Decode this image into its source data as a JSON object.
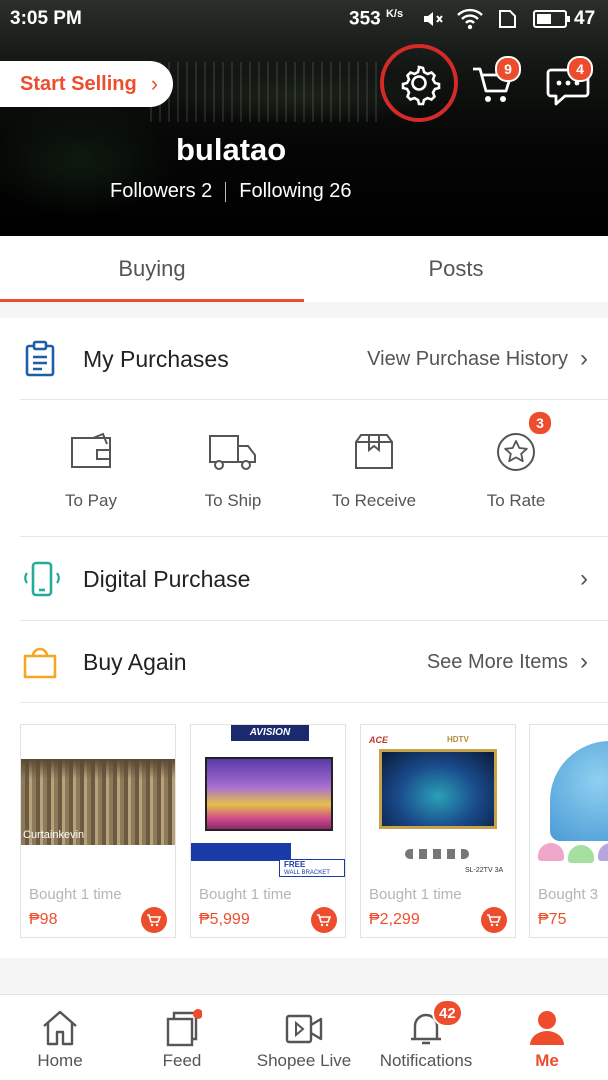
{
  "status_bar": {
    "time": "3:05 PM",
    "speed": "353",
    "speed_unit": "K/s",
    "battery": "47",
    "icons": [
      "mute-icon",
      "wifi-icon",
      "sim-icon",
      "battery-icon"
    ]
  },
  "header": {
    "start_selling": "Start Selling",
    "username": "bulatao",
    "followers": "Followers 2",
    "following": "Following 26",
    "cart_badge": "9",
    "chat_badge": "4"
  },
  "tabs": [
    {
      "label": "Buying",
      "active": true
    },
    {
      "label": "Posts",
      "active": false
    }
  ],
  "purchases": {
    "title": "My Purchases",
    "link": "View Purchase History"
  },
  "order_status": [
    {
      "label": "To Pay",
      "icon": "wallet-icon"
    },
    {
      "label": "To Ship",
      "icon": "truck-icon"
    },
    {
      "label": "To Receive",
      "icon": "box-icon"
    },
    {
      "label": "To Rate",
      "icon": "star-icon",
      "badge": "3"
    }
  ],
  "digital": {
    "title": "Digital Purchase"
  },
  "buy_again": {
    "title": "Buy Again",
    "link": "See More Items"
  },
  "products": [
    {
      "bought": "Bought 1 time",
      "price": "₱98",
      "image_caption": "Curtainkevin"
    },
    {
      "bought": "Bought 1 time",
      "price": "₱5,999",
      "image_brand": "AVISION",
      "image_promo": "FREE",
      "image_promo_sub": "WALL BRACKET"
    },
    {
      "bought": "Bought 1 time",
      "price": "₱2,299",
      "image_brand": "ACE",
      "image_tag": "HDTV",
      "image_model": "SL-22TV 3A"
    },
    {
      "bought": "Bought 3",
      "price": "₱75"
    }
  ],
  "bottom_nav": [
    {
      "label": "Home",
      "icon": "home-icon"
    },
    {
      "label": "Feed",
      "icon": "feed-icon"
    },
    {
      "label": "Shopee Live",
      "icon": "live-video-icon"
    },
    {
      "label": "Notifications",
      "icon": "bell-icon",
      "badge": "42"
    },
    {
      "label": "Me",
      "icon": "person-icon",
      "active": true
    }
  ],
  "colors": {
    "accent": "#ee4d2d",
    "settings_ring": "#d42a2a",
    "digital_icon": "#26aa99",
    "buy_again_icon": "#f5a623",
    "purchases_icon": "#1e5fa8"
  }
}
